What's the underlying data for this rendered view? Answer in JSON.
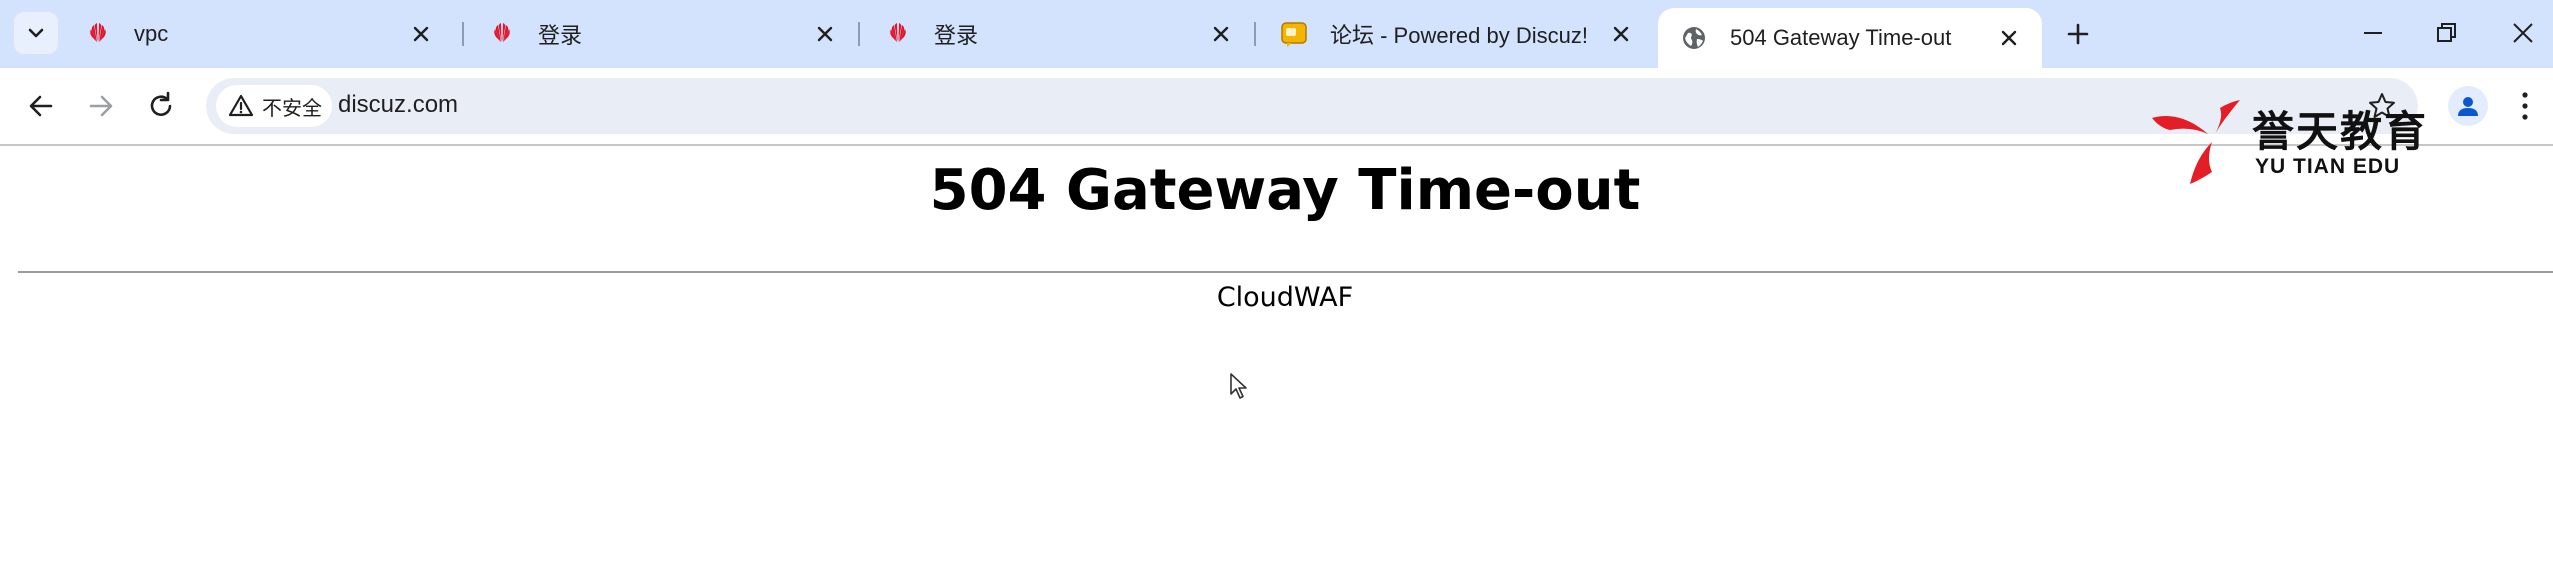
{
  "tabs": [
    {
      "title": "vpc",
      "favicon": "huawei-icon"
    },
    {
      "title": "登录",
      "favicon": "huawei-icon"
    },
    {
      "title": "登录",
      "favicon": "huawei-icon"
    },
    {
      "title": "论坛 - Powered by Discuz!",
      "favicon": "discuz-forum-icon"
    },
    {
      "title": "504 Gateway Time-out",
      "favicon": "globe-icon",
      "active": true
    }
  ],
  "toolbar": {
    "security_label": "不安全",
    "url": "discuz.com"
  },
  "watermark": {
    "name_cn": "誉天教育",
    "name_en": "YU TIAN EDU"
  },
  "page": {
    "heading": "504 Gateway Time-out",
    "server": "CloudWAF"
  },
  "colors": {
    "tabstrip": "#d3e3fd",
    "omnibox": "#e9eef6",
    "huawei_red": "#e0182d",
    "logo_red": "#e41e26"
  }
}
